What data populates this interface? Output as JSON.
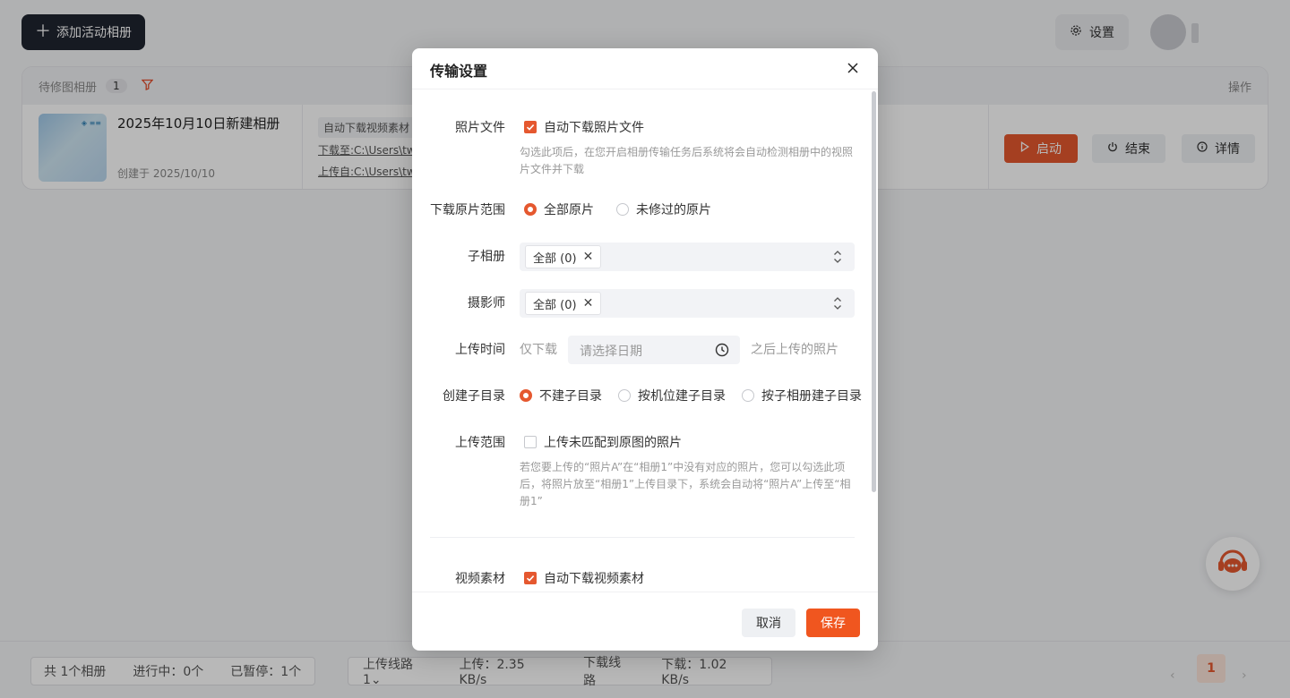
{
  "toolbar": {
    "add_album_label": "添加活动相册",
    "settings_label": "设置"
  },
  "table": {
    "header_label": "待修图相册",
    "header_count": "1",
    "ops_label": "操作",
    "rows": [
      {
        "title": "2025年10月10日新建相册",
        "created": "创建于 2025/10/10",
        "tag": "自动下载视频素材",
        "download_path": "下载至:C:\\Users\\tw",
        "upload_path": "上传自:C:\\Users\\tw",
        "start_label": "启动",
        "end_label": "结束",
        "detail_label": "详情"
      }
    ]
  },
  "status_bar": {
    "total": "共 1个相册",
    "in_progress": "进行中：0个",
    "paused": "已暂停：1个",
    "upload_route": "上传线路1",
    "upload_speed": "上传：2.35 KB/s",
    "download_route": "下载线路",
    "download_speed": "下载：1.02 KB/s",
    "current_page": "1"
  },
  "modal": {
    "title": "传输设置",
    "photo_file": {
      "label": "照片文件",
      "checkbox_label": "自动下载照片文件",
      "checked": true,
      "hint": "勾选此项后，在您开启相册传输任务后系统将会自动检测相册中的视照片文件并下载"
    },
    "download_range": {
      "label": "下载原片范围",
      "options": [
        "全部原片",
        "未修过的原片"
      ],
      "selected": "全部原片"
    },
    "sub_album": {
      "label": "子相册",
      "chip": "全部 (0)"
    },
    "photographer": {
      "label": "摄影师",
      "chip": "全部 (0)"
    },
    "upload_time": {
      "label": "上传时间",
      "prefix": "仅下载",
      "placeholder": "请选择日期",
      "suffix": "之后上传的照片"
    },
    "create_subdir": {
      "label": "创建子目录",
      "options": [
        "不建子目录",
        "按机位建子目录",
        "按子相册建子目录"
      ],
      "selected": "不建子目录"
    },
    "upload_range": {
      "label": "上传范围",
      "checkbox_label": "上传未匹配到原图的照片",
      "checked": false,
      "hint": "若您要上传的“照片A”在“相册1”中没有对应的照片，您可以勾选此项后，将照片放至“相册1”上传目录下，系统会自动将“照片A”上传至“相册1”"
    },
    "video": {
      "label": "视频素材",
      "checkbox_label": "自动下载视频素材",
      "checked": true
    },
    "cancel_label": "取消",
    "save_label": "保存"
  },
  "colors": {
    "accent": "#e5582f",
    "save_button": "#f0561f",
    "dark_button": "#1f2430"
  },
  "icons": [
    "plus-icon",
    "gear-icon",
    "filter-icon",
    "play-icon",
    "power-icon",
    "info-icon",
    "close-icon",
    "updown-icon",
    "clock-icon",
    "headset-icon"
  ]
}
